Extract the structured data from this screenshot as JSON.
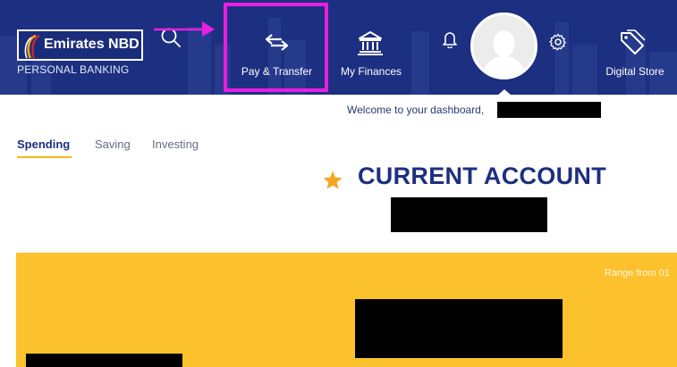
{
  "colors": {
    "header_bg": "#1c2f80",
    "accent_yellow": "#fbc22e",
    "tab_underline": "#f7b51c",
    "highlight_magenta": "#e81fe1",
    "title_blue": "#1c2f80",
    "star": "#f5a623"
  },
  "header": {
    "brand_name": "Emirates NBD",
    "brand_sub": "PERSONAL BANKING",
    "icons": {
      "brand": "emirates-nbd-logo-icon",
      "search": "search-icon",
      "pay_transfer": "transfer-arrows-icon",
      "my_finances": "bank-building-icon",
      "notifications": "bell-icon",
      "settings": "gear-icon",
      "digital_store": "price-tag-icon"
    },
    "nav": {
      "pay_transfer": "Pay & Transfer",
      "my_finances": "My Finances",
      "digital_store": "Digital Store"
    }
  },
  "welcome": {
    "text": "Welcome to your dashboard,"
  },
  "tabs": [
    {
      "label": "Spending",
      "active": true
    },
    {
      "label": "Saving",
      "active": false
    },
    {
      "label": "Investing",
      "active": false
    }
  ],
  "account": {
    "title": "CURRENT ACCOUNT",
    "star_icon": "star-icon"
  },
  "balance_card": {
    "range_text": "Range from 01"
  }
}
